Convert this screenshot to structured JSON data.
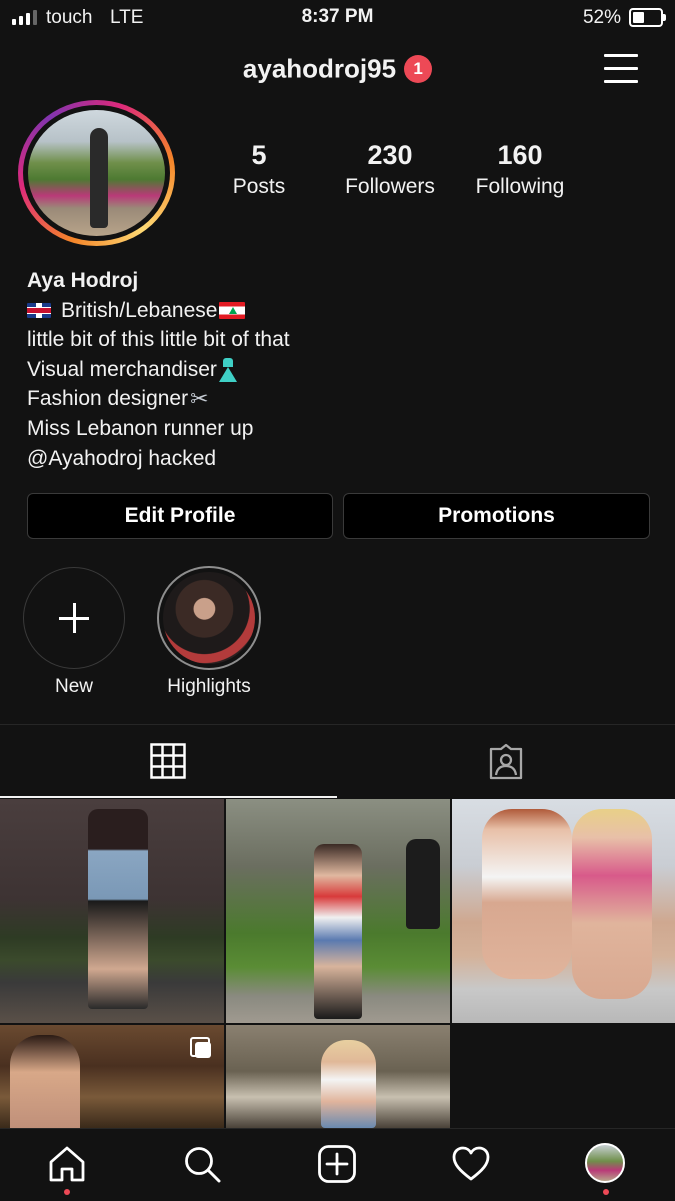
{
  "status_bar": {
    "carrier": "touch",
    "network": "LTE",
    "time": "8:37 PM",
    "battery": "52%",
    "battery_level": 0.52,
    "signal_bars": 3
  },
  "header": {
    "username": "ayahodroj95",
    "notification_count": "1",
    "menu_icon": "hamburger-menu-icon"
  },
  "stats": {
    "posts": {
      "value": "5",
      "label": "Posts"
    },
    "followers": {
      "value": "230",
      "label": "Followers"
    },
    "following": {
      "value": "160",
      "label": "Following"
    }
  },
  "bio": {
    "name": "Aya Hodroj",
    "line1": "British/Lebanese",
    "line2": "little bit of this little bit of that",
    "line3": "Visual merchandiser",
    "line4": "Fashion designer",
    "line5": "Miss Lebanon runner up",
    "line6": "@Ayahodroj hacked"
  },
  "buttons": {
    "edit_profile": "Edit Profile",
    "promotions": "Promotions"
  },
  "highlights": [
    {
      "label": "New"
    },
    {
      "label": "Highlights"
    }
  ],
  "tabs": [
    "grid-icon",
    "tagged-icon"
  ],
  "nav": [
    "home-icon",
    "search-icon",
    "add-post-icon",
    "heart-icon",
    "profile-avatar"
  ],
  "colors": {
    "background": "#121212",
    "badge": "#ed4956",
    "border": "#3a3a3a"
  }
}
